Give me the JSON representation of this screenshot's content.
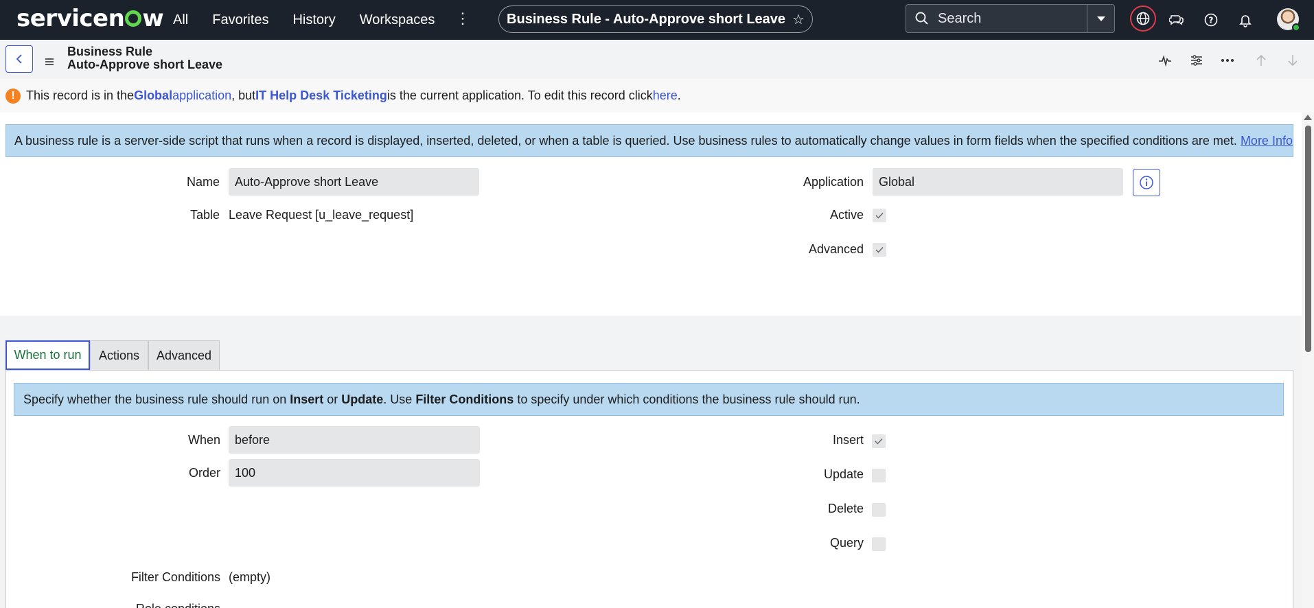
{
  "nav": {
    "logo": "servicenow",
    "links": [
      "All",
      "Favorites",
      "History",
      "Workspaces"
    ],
    "record_title": "Business Rule - Auto-Approve short Leave",
    "search_placeholder": "Search"
  },
  "form_header": {
    "type": "Business Rule",
    "name": "Auto-Approve short Leave"
  },
  "warning": {
    "p1": "This record is in the ",
    "app": "Global",
    "app_word": " application",
    "p2": ", but ",
    "current_app": "IT Help Desk Ticketing",
    "p3": " is the current application. To edit this record click ",
    "link": "here",
    "p4": "."
  },
  "info": {
    "text": "A business rule is a server-side script that runs when a record is displayed, inserted, deleted, or when a table is queried. Use business rules to automatically change values in form fields when the specified conditions are met. ",
    "link": "More Info"
  },
  "fields": {
    "name_label": "Name",
    "name_value": "Auto-Approve short Leave",
    "table_label": "Table",
    "table_value": "Leave Request [u_leave_request]",
    "application_label": "Application",
    "application_value": "Global",
    "active_label": "Active",
    "active_checked": true,
    "advanced_label": "Advanced",
    "advanced_checked": true
  },
  "tabs": [
    {
      "label": "When to run",
      "active": true
    },
    {
      "label": "Actions",
      "active": false
    },
    {
      "label": "Advanced",
      "active": false
    }
  ],
  "when_to_run": {
    "info": {
      "p1": "Specify whether the business rule should run on ",
      "insert": "Insert",
      "p2": " or ",
      "update": "Update",
      "p3": ". Use ",
      "filter": "Filter Conditions",
      "p4": " to specify under which conditions the business rule should run."
    },
    "when_label": "When",
    "when_value": "before",
    "order_label": "Order",
    "order_value": "100",
    "insert_label": "Insert",
    "insert_checked": true,
    "update_label": "Update",
    "update_checked": false,
    "delete_label": "Delete",
    "delete_checked": false,
    "query_label": "Query",
    "query_checked": false,
    "filter_label": "Filter Conditions",
    "filter_value": "(empty)",
    "role_label": "Role conditions"
  }
}
